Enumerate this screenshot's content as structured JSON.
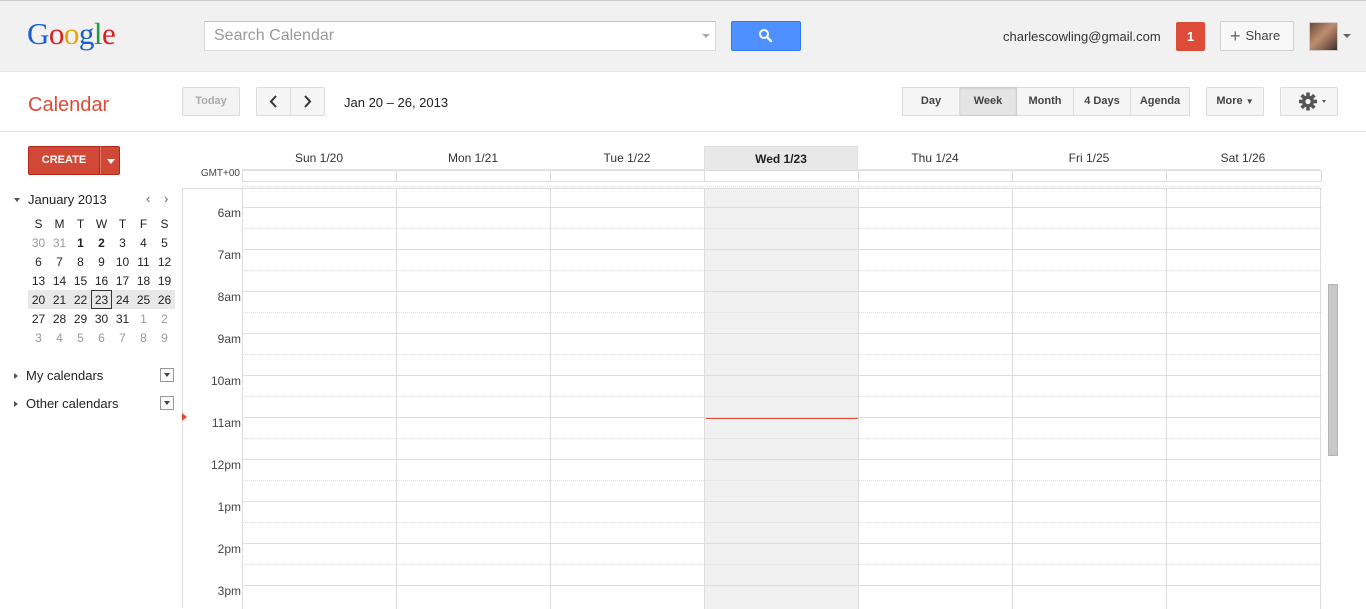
{
  "header": {
    "logo": {
      "letters": [
        {
          "ch": "G",
          "color": "#1a5fd0"
        },
        {
          "ch": "o",
          "color": "#dd1e1e"
        },
        {
          "ch": "o",
          "color": "#e8a400"
        },
        {
          "ch": "g",
          "color": "#1a5fd0"
        },
        {
          "ch": "l",
          "color": "#1b9e3b"
        },
        {
          "ch": "e",
          "color": "#dd1e1e"
        }
      ]
    },
    "search_placeholder": "Search Calendar",
    "search_value": "",
    "user_email": "charlescowling@gmail.com",
    "notification_count": "1",
    "share_label": "Share"
  },
  "toolbar": {
    "app_title": "Calendar",
    "today_label": "Today",
    "date_range": "Jan 20 – 26, 2013",
    "views": [
      "Day",
      "Week",
      "Month",
      "4 Days",
      "Agenda"
    ],
    "active_view": "Week",
    "more_label": "More"
  },
  "sidebar": {
    "create_label": "CREATE",
    "mini_calendar": {
      "title": "January 2013",
      "weekday_initials": [
        "S",
        "M",
        "T",
        "W",
        "T",
        "F",
        "S"
      ],
      "weeks": [
        [
          [
            "30",
            "out"
          ],
          [
            "31",
            "out"
          ],
          [
            "1",
            "bold"
          ],
          [
            "2",
            "bold"
          ],
          [
            "3",
            ""
          ],
          [
            "4",
            ""
          ],
          [
            "5",
            ""
          ]
        ],
        [
          [
            "6",
            ""
          ],
          [
            "7",
            ""
          ],
          [
            "8",
            ""
          ],
          [
            "9",
            ""
          ],
          [
            "10",
            ""
          ],
          [
            "11",
            ""
          ],
          [
            "12",
            ""
          ]
        ],
        [
          [
            "13",
            ""
          ],
          [
            "14",
            ""
          ],
          [
            "15",
            ""
          ],
          [
            "16",
            ""
          ],
          [
            "17",
            ""
          ],
          [
            "18",
            ""
          ],
          [
            "19",
            ""
          ]
        ],
        [
          [
            "20",
            ""
          ],
          [
            "21",
            ""
          ],
          [
            "22",
            ""
          ],
          [
            "23",
            "today"
          ],
          [
            "24",
            ""
          ],
          [
            "25",
            ""
          ],
          [
            "26",
            ""
          ]
        ],
        [
          [
            "27",
            ""
          ],
          [
            "28",
            ""
          ],
          [
            "29",
            ""
          ],
          [
            "30",
            ""
          ],
          [
            "31",
            ""
          ],
          [
            "1",
            "out"
          ],
          [
            "2",
            "out"
          ]
        ],
        [
          [
            "3",
            "out"
          ],
          [
            "4",
            "out"
          ],
          [
            "5",
            "out"
          ],
          [
            "6",
            "out"
          ],
          [
            "7",
            "out"
          ],
          [
            "8",
            "out"
          ],
          [
            "9",
            "out"
          ]
        ]
      ],
      "current_week_index": 3
    },
    "sections": [
      "My calendars",
      "Other calendars"
    ]
  },
  "week": {
    "timezone": "GMT+00",
    "days": [
      "Sun 1/20",
      "Mon 1/21",
      "Tue 1/22",
      "Wed 1/23",
      "Thu 1/24",
      "Fri 1/25",
      "Sat 1/26"
    ],
    "today_index": 3,
    "hours": [
      "6am",
      "7am",
      "8am",
      "9am",
      "10am",
      "11am",
      "12pm",
      "1pm",
      "2pm",
      "3pm"
    ]
  },
  "colors": {
    "brand_red": "#dd4b39",
    "search_blue": "#4d90fe"
  }
}
